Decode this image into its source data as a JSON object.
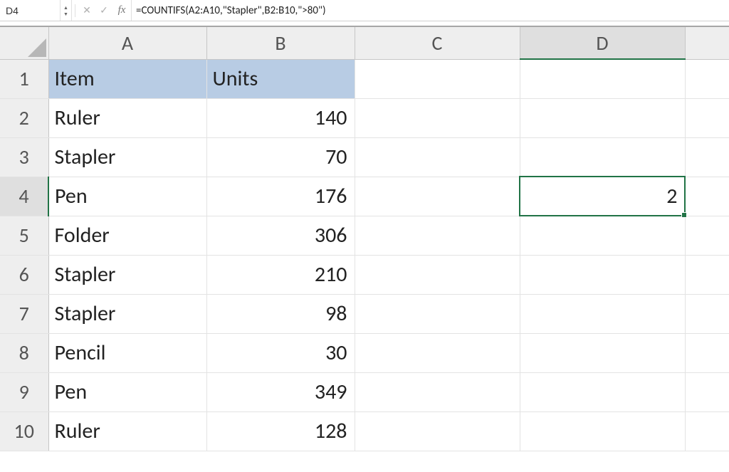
{
  "namebox": "D4",
  "formula": "=COUNTIFS(A2:A10,\"Stapler\",B2:B10,\">80\")",
  "fx": "fx",
  "col_headers": [
    "A",
    "B",
    "C",
    "D"
  ],
  "row_headers": [
    "1",
    "2",
    "3",
    "4",
    "5",
    "6",
    "7",
    "8",
    "9",
    "10"
  ],
  "active_col_index": 3,
  "active_row_index": 3,
  "header": {
    "A": "Item",
    "B": "Units"
  },
  "rows": [
    {
      "A": "Ruler",
      "B": "140",
      "D": ""
    },
    {
      "A": "Stapler",
      "B": "70",
      "D": ""
    },
    {
      "A": "Pen",
      "B": "176",
      "D": "2"
    },
    {
      "A": "Folder",
      "B": "306",
      "D": ""
    },
    {
      "A": "Stapler",
      "B": "210",
      "D": ""
    },
    {
      "A": "Stapler",
      "B": "98",
      "D": ""
    },
    {
      "A": "Pencil",
      "B": "30",
      "D": ""
    },
    {
      "A": "Pen",
      "B": "349",
      "D": ""
    },
    {
      "A": "Ruler",
      "B": "128",
      "D": ""
    }
  ],
  "chart_data": {
    "type": "table",
    "title": "",
    "columns": [
      "Item",
      "Units"
    ],
    "data": [
      [
        "Ruler",
        140
      ],
      [
        "Stapler",
        70
      ],
      [
        "Pen",
        176
      ],
      [
        "Folder",
        306
      ],
      [
        "Stapler",
        210
      ],
      [
        "Stapler",
        98
      ],
      [
        "Pencil",
        30
      ],
      [
        "Pen",
        349
      ],
      [
        "Ruler",
        128
      ]
    ],
    "formula_result_cell": "D4",
    "formula_result_value": 2
  }
}
